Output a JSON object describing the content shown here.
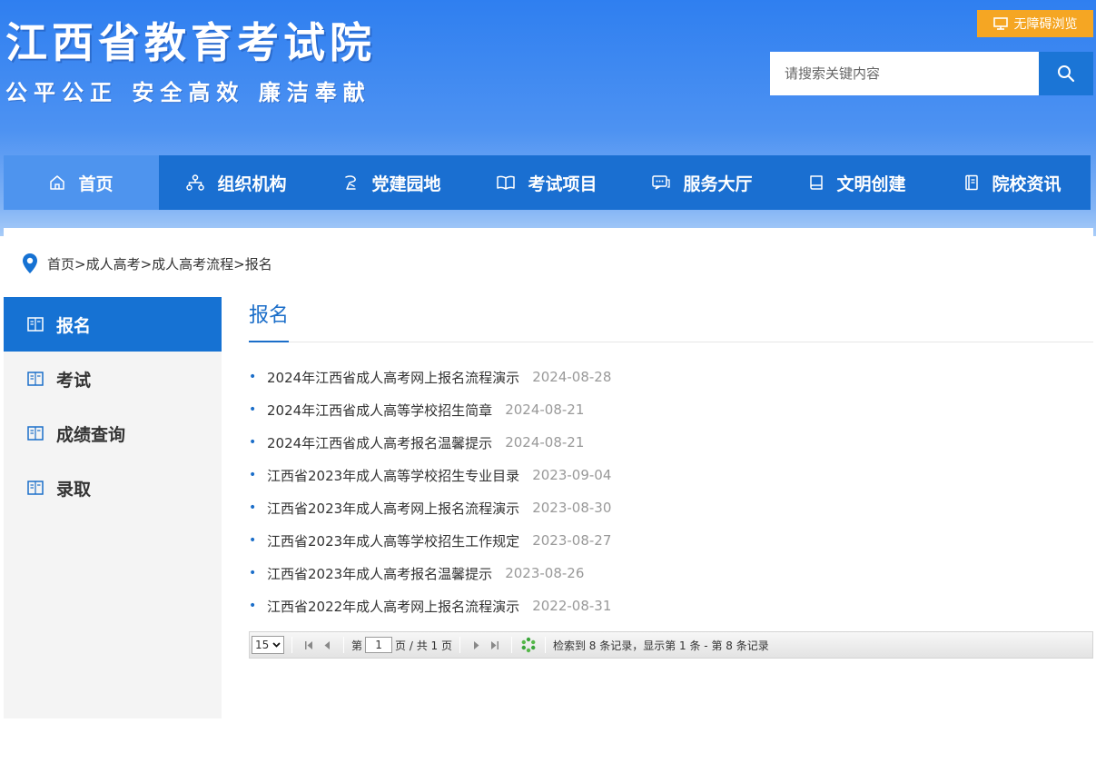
{
  "header": {
    "site_title": "江西省教育考试院",
    "slogan": "公平公正 安全高效 廉洁奉献",
    "accessibility_label": "无障碍浏览",
    "search": {
      "placeholder": "请搜索关键内容"
    }
  },
  "nav": [
    {
      "label": "首页",
      "icon": "home-icon"
    },
    {
      "label": "组织机构",
      "icon": "org-chart-icon"
    },
    {
      "label": "党建园地",
      "icon": "party-icon"
    },
    {
      "label": "考试项目",
      "icon": "open-book-icon"
    },
    {
      "label": "服务大厅",
      "icon": "service-chat-icon"
    },
    {
      "label": "文明创建",
      "icon": "book-icon"
    },
    {
      "label": "院校资讯",
      "icon": "notebook-icon"
    }
  ],
  "breadcrumb": "首页>成人高考>成人高考流程>报名",
  "sidebar": [
    {
      "label": "报名"
    },
    {
      "label": "考试"
    },
    {
      "label": "成绩查询"
    },
    {
      "label": "录取"
    }
  ],
  "main": {
    "title": "报名",
    "articles": [
      {
        "title": "2024年江西省成人高考网上报名流程演示",
        "date": "2024-08-28"
      },
      {
        "title": "2024年江西省成人高等学校招生简章",
        "date": "2024-08-21"
      },
      {
        "title": "2024年江西省成人高考报名温馨提示",
        "date": "2024-08-21"
      },
      {
        "title": "江西省2023年成人高等学校招生专业目录",
        "date": "2023-09-04"
      },
      {
        "title": "江西省2023年成人高考网上报名流程演示",
        "date": "2023-08-30"
      },
      {
        "title": "江西省2023年成人高等学校招生工作规定",
        "date": "2023-08-27"
      },
      {
        "title": "江西省2023年成人高考报名温馨提示",
        "date": "2023-08-26"
      },
      {
        "title": "江西省2022年成人高考网上报名流程演示",
        "date": "2022-08-31"
      }
    ]
  },
  "pager": {
    "page_size": "15",
    "page_label_prefix": "第",
    "current_page": "1",
    "page_label_suffix": "页 / 共 1 页",
    "summary": "检索到 8 条记录，显示第 1 条 - 第 8 条记录"
  },
  "colors": {
    "nav_bg": "#1a6fd1",
    "nav_active": "#4e94ee",
    "accent": "#1b6ec9",
    "accessibility_btn": "#f5a623"
  }
}
